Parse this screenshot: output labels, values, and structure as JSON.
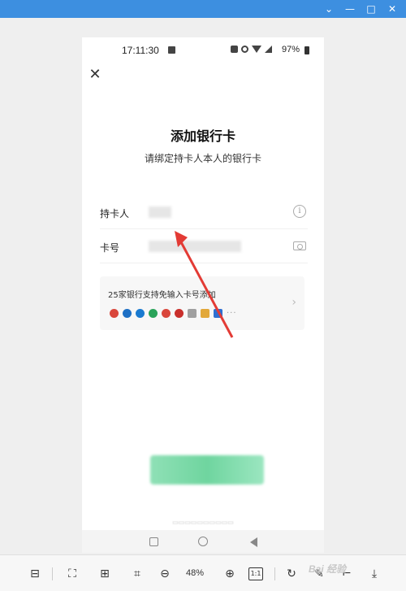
{
  "status_bar": {
    "time": "17:11:30",
    "battery": "97%"
  },
  "page": {
    "title": "添加银行卡",
    "subtitle": "请绑定持卡人本人的银行卡"
  },
  "form": {
    "holder_label": "持卡人",
    "card_label": "卡号"
  },
  "banks": {
    "hint": "25家银行支持免输入卡号添加",
    "more": "···",
    "icon_colors": [
      "#d9463b",
      "#1d6fc4",
      "#1a7ad0",
      "#2aa35a",
      "#d9463b",
      "#c9302c",
      "#a0a0a0",
      "#e2a83a",
      "#2f6fd1"
    ]
  },
  "toolbar": {
    "zoom": "48%",
    "ratio": "1:1",
    "watermark": "Bai 经验"
  },
  "colors": {
    "titlebar": "#3d8fe0",
    "arrow": "#e33b35",
    "confirm_button": "#6fd59f"
  }
}
